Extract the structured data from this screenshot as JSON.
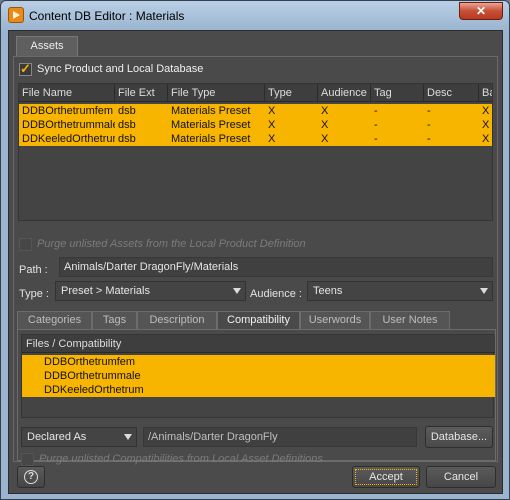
{
  "window": {
    "title": "Content DB Editor : Materials",
    "close_glyph": "✕"
  },
  "tabs": {
    "assets": "Assets"
  },
  "sync": {
    "label": "Sync Product and Local Database",
    "checked": true
  },
  "table": {
    "columns": [
      "File Name",
      "File Ext",
      "File Type",
      "Type",
      "Audience",
      "Tag",
      "Desc",
      "Bas"
    ],
    "rows": [
      [
        "DDBOrthetrumfem",
        "dsb",
        "Materials Preset",
        "X",
        "X",
        "-",
        "-",
        "X"
      ],
      [
        "DDBOrthetrummale",
        "dsb",
        "Materials Preset",
        "X",
        "X",
        "-",
        "-",
        "X"
      ],
      [
        "DDKeeledOrthetrum",
        "dsb",
        "Materials Preset",
        "X",
        "X",
        "-",
        "-",
        "X"
      ]
    ]
  },
  "purge_assets": {
    "label": "Purge unlisted Assets from the Local Product Definition"
  },
  "path": {
    "label": "Path :",
    "value": "Animals/Darter DragonFly/Materials"
  },
  "type": {
    "label": "Type :",
    "value": "Preset > Materials"
  },
  "audience": {
    "label": "Audience :",
    "value": "Teens"
  },
  "subtabs": [
    "Categories",
    "Tags",
    "Description",
    "Compatibility",
    "Userwords",
    "User Notes"
  ],
  "active_subtab": "Compatibility",
  "compat": {
    "header": "Files / Compatibility",
    "files": [
      "DDBOrthetrumfem",
      "DDBOrthetrummale",
      "DDKeeledOrthetrum"
    ],
    "declared_as": "Declared As",
    "location": "/Animals/Darter DragonFly",
    "database_button": "Database...",
    "purge_label": "Purge unlisted Compatibilities from Local Asset Definitions"
  },
  "footer": {
    "help": "?",
    "accept": "Accept",
    "cancel": "Cancel"
  },
  "colors": {
    "selection": "#f7b500",
    "panel": "#4a4a4a",
    "accent_check": "#f2b600"
  }
}
